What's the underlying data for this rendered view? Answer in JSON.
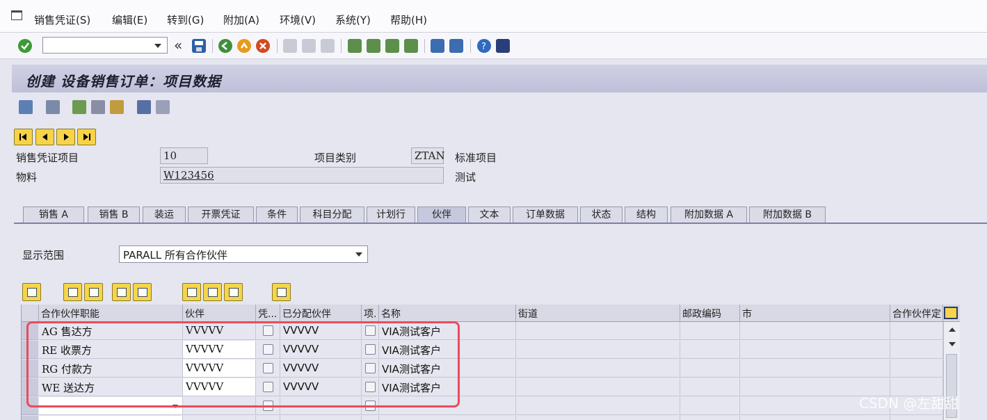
{
  "menu": [
    "销售凭证(S)",
    "编辑(E)",
    "转到(G)",
    "附加(A)",
    "环境(V)",
    "系统(Y)",
    "帮助(H)"
  ],
  "toolbar": {
    "command_value": "",
    "back_label": "«"
  },
  "title": "创建 设备销售订单：项目数据",
  "header": {
    "item_label": "销售凭证项目",
    "item_value": "10",
    "category_label": "项目类别",
    "category_value": "ZTAN",
    "category_text": "标准项目",
    "material_label": "物料",
    "material_value": "W123456",
    "material_text": "测试"
  },
  "tabs": [
    "销售 A",
    "销售 B",
    "装运",
    "开票凭证",
    "条件",
    "科目分配",
    "计划行",
    "伙伴",
    "文本",
    "订单数据",
    "状态",
    "结构",
    "附加数据 A",
    "附加数据 B"
  ],
  "active_tab": "伙伴",
  "display_range": {
    "label": "显示范围",
    "value": "PARALL 所有合作伙伴"
  },
  "columns": [
    "合作伙伴职能",
    "伙伴",
    "凭...",
    "已分配伙伴",
    "项.",
    "名称",
    "街道",
    "邮政编码",
    "市",
    "合作伙伴定"
  ],
  "rows": [
    {
      "func": "AG  售达方",
      "partner": "VVVVV",
      "assigned": "VVVVV",
      "name": "VIA测试客户"
    },
    {
      "func": "RE  收票方",
      "partner": "VVVVV",
      "assigned": "VVVVV",
      "name": "VIA测试客户"
    },
    {
      "func": "RG  付款方",
      "partner": "VVVVV",
      "assigned": "VVVVV",
      "name": "VIA测试客户"
    },
    {
      "func": "WE  送达方",
      "partner": "VVVVV",
      "assigned": "VVVVV",
      "name": "VIA测试客户"
    }
  ],
  "watermark": "CSDN @左甜甜",
  "colors": {
    "accent_highlight": "#ec4b5e",
    "button_yellow": "#f6d54a",
    "title_bar": "#c6c7de"
  },
  "icons": [
    "check-icon",
    "save-icon",
    "back-icon",
    "exit-icon",
    "cancel-icon",
    "print-icon",
    "find-icon",
    "find-next-icon",
    "first-page-icon",
    "prev-page-icon",
    "next-page-icon",
    "last-page-icon",
    "new-session-icon",
    "shortcut-icon",
    "help-icon",
    "layout-icon"
  ]
}
